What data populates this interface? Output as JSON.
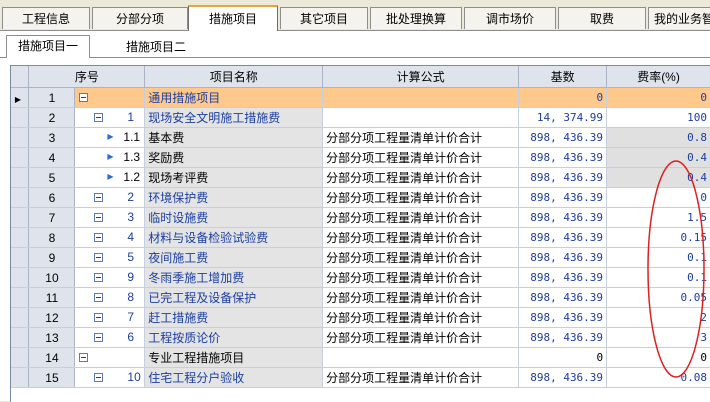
{
  "main_tabs": [
    {
      "label": "工程信息",
      "active": false
    },
    {
      "label": "分部分项",
      "active": false
    },
    {
      "label": "措施项目",
      "active": true
    },
    {
      "label": "其它项目",
      "active": false
    },
    {
      "label": "批处理换算",
      "active": false
    },
    {
      "label": "调市场价",
      "active": false
    },
    {
      "label": "取费",
      "active": false
    },
    {
      "label": "我的业务智",
      "active": false
    }
  ],
  "sub_tabs": [
    {
      "label": "措施项目一",
      "active": true
    },
    {
      "label": "措施项目二",
      "active": false
    }
  ],
  "columns": {
    "seq": "序号",
    "name": "项目名称",
    "formula": "计算公式",
    "base": "基数",
    "rate": "费率(%)"
  },
  "rows": [
    {
      "n": "1",
      "toggle": true,
      "level": 0,
      "code": "",
      "name": "通用措施项目",
      "formula": "",
      "base": "0",
      "rate": "0",
      "selected": true
    },
    {
      "n": "2",
      "toggle": true,
      "level": 1,
      "code": "1",
      "name": "现场安全文明施工措施费",
      "formula": "",
      "base": "14, 374.99",
      "rate": "100"
    },
    {
      "n": "3",
      "toggle": false,
      "level": 2,
      "code": "1.1",
      "name": "基本费",
      "formula": "分部分项工程量清单计价合计",
      "base": "898, 436.39",
      "rate": "0.8"
    },
    {
      "n": "4",
      "toggle": false,
      "level": 2,
      "code": "1.3",
      "name": "奖励费",
      "formula": "分部分项工程量清单计价合计",
      "base": "898, 436.39",
      "rate": "0.4"
    },
    {
      "n": "5",
      "toggle": false,
      "level": 2,
      "code": "1.2",
      "name": "现场考评费",
      "formula": "分部分项工程量清单计价合计",
      "base": "898, 436.39",
      "rate": "0.4"
    },
    {
      "n": "6",
      "toggle": true,
      "level": 1,
      "code": "2",
      "name": "环境保护费",
      "formula": "分部分项工程量清单计价合计",
      "base": "898, 436.39",
      "rate": "0"
    },
    {
      "n": "7",
      "toggle": true,
      "level": 1,
      "code": "3",
      "name": "临时设施费",
      "formula": "分部分项工程量清单计价合计",
      "base": "898, 436.39",
      "rate": "1.5"
    },
    {
      "n": "8",
      "toggle": true,
      "level": 1,
      "code": "4",
      "name": "材料与设备检验试验费",
      "formula": "分部分项工程量清单计价合计",
      "base": "898, 436.39",
      "rate": "0.15"
    },
    {
      "n": "9",
      "toggle": true,
      "level": 1,
      "code": "5",
      "name": "夜间施工费",
      "formula": "分部分项工程量清单计价合计",
      "base": "898, 436.39",
      "rate": "0.1"
    },
    {
      "n": "10",
      "toggle": true,
      "level": 1,
      "code": "9",
      "name": "冬雨季施工增加费",
      "formula": "分部分项工程量清单计价合计",
      "base": "898, 436.39",
      "rate": "0.1"
    },
    {
      "n": "11",
      "toggle": true,
      "level": 1,
      "code": "8",
      "name": "已完工程及设备保护",
      "formula": "分部分项工程量清单计价合计",
      "base": "898, 436.39",
      "rate": "0.05"
    },
    {
      "n": "12",
      "toggle": true,
      "level": 1,
      "code": "7",
      "name": "赶工措施费",
      "formula": "分部分项工程量清单计价合计",
      "base": "898, 436.39",
      "rate": "2"
    },
    {
      "n": "13",
      "toggle": true,
      "level": 1,
      "code": "6",
      "name": "工程按质论价",
      "formula": "分部分项工程量清单计价合计",
      "base": "898, 436.39",
      "rate": "3"
    },
    {
      "n": "14",
      "toggle": true,
      "level": 0,
      "code": "",
      "name": "专业工程措施项目",
      "formula": "",
      "base": "0",
      "rate": "0"
    },
    {
      "n": "15",
      "toggle": true,
      "level": 1,
      "code": "10",
      "name": "住宅工程分户验收",
      "formula": "分部分项工程量清单计价合计",
      "base": "898, 436.39",
      "rate": "0.08"
    }
  ]
}
